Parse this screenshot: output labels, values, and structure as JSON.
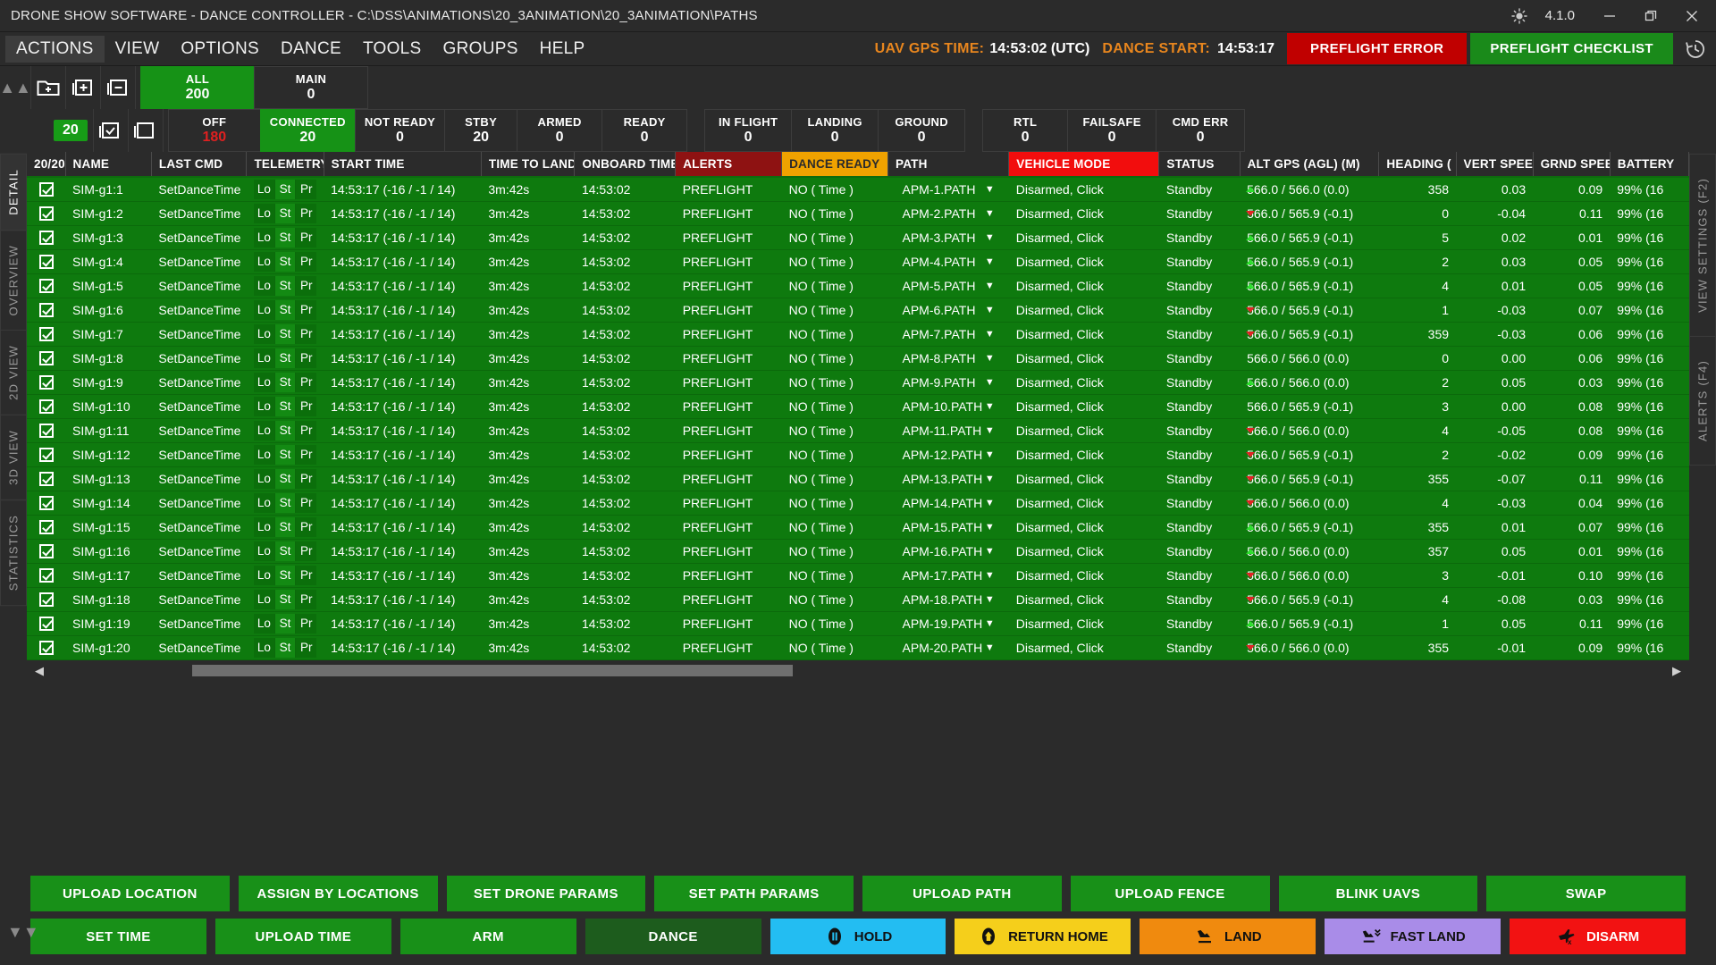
{
  "window": {
    "title": "DRONE SHOW SOFTWARE - DANCE CONTROLLER - C:\\DSS\\ANIMATIONS\\20_3ANIMATION\\20_3ANIMATION\\PATHS",
    "version": "4.1.0",
    "minimize_label": "—",
    "maximize_label": "❐",
    "close_label": "✕",
    "brightness_icon": "sun-icon"
  },
  "menu": {
    "items": [
      {
        "label": "ACTIONS",
        "active": true
      },
      {
        "label": "VIEW",
        "active": false
      },
      {
        "label": "OPTIONS",
        "active": false
      },
      {
        "label": "DANCE",
        "active": false
      },
      {
        "label": "TOOLS",
        "active": false
      },
      {
        "label": "GROUPS",
        "active": false
      },
      {
        "label": "HELP",
        "active": false
      }
    ],
    "gps_label": "UAV GPS TIME:",
    "gps_value": "14:53:02 (UTC)",
    "dance_start_label": "DANCE START:",
    "dance_start_value": "14:53:17",
    "preflight_error": "PREFLIGHT ERROR",
    "preflight_checklist": "PREFLIGHT CHECKLIST",
    "history_icon": "history-icon",
    "colors": {
      "accent_orange": "#e8861e",
      "error_red": "#c00000",
      "ok_green": "#1a8a1a"
    }
  },
  "toolbar": {
    "collapse_icon": "chevron-up-icon",
    "row1_icons": [
      "new-folder-icon",
      "add-group-icon",
      "remove-group-icon"
    ],
    "row2_icons": [
      "select-all-icon",
      "deselect-all-icon"
    ],
    "selected_count": "20",
    "groups": [
      {
        "label": "ALL",
        "value": "200",
        "highlight": true
      },
      {
        "label": "MAIN",
        "value": "0",
        "highlight": false
      }
    ],
    "statuses_a": [
      {
        "label": "OFF",
        "value": "180",
        "value_red": true,
        "highlight": false
      },
      {
        "label": "CONNECTED",
        "value": "20",
        "value_red": false,
        "highlight": true
      },
      {
        "label": "NOT READY",
        "value": "0",
        "value_red": false,
        "highlight": false
      },
      {
        "label": "STBY",
        "value": "20",
        "value_red": false,
        "highlight": false
      },
      {
        "label": "ARMED",
        "value": "0",
        "value_red": false,
        "highlight": false
      },
      {
        "label": "READY",
        "value": "0",
        "value_red": false,
        "highlight": false
      }
    ],
    "statuses_b": [
      {
        "label": "IN FLIGHT",
        "value": "0"
      },
      {
        "label": "LANDING",
        "value": "0"
      },
      {
        "label": "GROUND",
        "value": "0"
      }
    ],
    "statuses_c": [
      {
        "label": "RTL",
        "value": "0"
      },
      {
        "label": "FAILSAFE",
        "value": "0"
      },
      {
        "label": "CMD ERR",
        "value": "0"
      }
    ]
  },
  "left_tabs": [
    {
      "label": "DETAIL",
      "active": true
    },
    {
      "label": "OVERVIEW",
      "active": false
    },
    {
      "label": "2D VIEW",
      "active": false
    },
    {
      "label": "3D VIEW",
      "active": false
    },
    {
      "label": "STATISTICS",
      "active": false
    }
  ],
  "right_tabs": [
    {
      "label": "VIEW SETTINGS  (F2)",
      "active": false
    },
    {
      "label": "ALERTS  (F4)",
      "active": false
    }
  ],
  "table": {
    "headers": [
      "20/20",
      "NAME",
      "LAST CMD",
      "TELEMETRY",
      "START TIME",
      "TIME TO LAND",
      "ONBOARD TIME",
      "ALERTS",
      "DANCE READY",
      "PATH",
      "VEHICLE MODE",
      "STATUS",
      "ALT GPS (AGL) (M)",
      "HEADING (",
      "VERT SPEED",
      "GRND SPEED",
      "BATTERY"
    ],
    "telemetry_sub": [
      "Lo",
      "St",
      "Pr"
    ],
    "rows": [
      {
        "checked": true,
        "name": "SIM-g1:1",
        "last_cmd": "SetDanceTime",
        "start_time": "14:53:17 (-16 / -1 / 14)",
        "time_to_land": "3m:42s",
        "onboard_time": "14:53:02",
        "alerts": "PREFLIGHT",
        "dance_ready": "NO ( Time )",
        "path": "APM-1.PATH",
        "vehicle_mode": "Disarmed, Click",
        "status": "Standby",
        "alt": "566.0 / 566.0 (0.0)",
        "trend": "up",
        "heading": "358",
        "vert_speed": "0.03",
        "grnd_speed": "0.09",
        "battery": "99% (16"
      },
      {
        "checked": true,
        "name": "SIM-g1:2",
        "last_cmd": "SetDanceTime",
        "start_time": "14:53:17 (-16 / -1 / 14)",
        "time_to_land": "3m:42s",
        "onboard_time": "14:53:02",
        "alerts": "PREFLIGHT",
        "dance_ready": "NO ( Time )",
        "path": "APM-2.PATH",
        "vehicle_mode": "Disarmed, Click",
        "status": "Standby",
        "alt": "566.0 / 565.9 (-0.1)",
        "trend": "down",
        "heading": "0",
        "vert_speed": "-0.04",
        "grnd_speed": "0.11",
        "battery": "99% (16"
      },
      {
        "checked": true,
        "name": "SIM-g1:3",
        "last_cmd": "SetDanceTime",
        "start_time": "14:53:17 (-16 / -1 / 14)",
        "time_to_land": "3m:42s",
        "onboard_time": "14:53:02",
        "alerts": "PREFLIGHT",
        "dance_ready": "NO ( Time )",
        "path": "APM-3.PATH",
        "vehicle_mode": "Disarmed, Click",
        "status": "Standby",
        "alt": "566.0 / 565.9 (-0.1)",
        "trend": "up",
        "heading": "5",
        "vert_speed": "0.02",
        "grnd_speed": "0.01",
        "battery": "99% (16"
      },
      {
        "checked": true,
        "name": "SIM-g1:4",
        "last_cmd": "SetDanceTime",
        "start_time": "14:53:17 (-16 / -1 / 14)",
        "time_to_land": "3m:42s",
        "onboard_time": "14:53:02",
        "alerts": "PREFLIGHT",
        "dance_ready": "NO ( Time )",
        "path": "APM-4.PATH",
        "vehicle_mode": "Disarmed, Click",
        "status": "Standby",
        "alt": "566.0 / 565.9 (-0.1)",
        "trend": "up",
        "heading": "2",
        "vert_speed": "0.03",
        "grnd_speed": "0.05",
        "battery": "99% (16"
      },
      {
        "checked": true,
        "name": "SIM-g1:5",
        "last_cmd": "SetDanceTime",
        "start_time": "14:53:17 (-16 / -1 / 14)",
        "time_to_land": "3m:42s",
        "onboard_time": "14:53:02",
        "alerts": "PREFLIGHT",
        "dance_ready": "NO ( Time )",
        "path": "APM-5.PATH",
        "vehicle_mode": "Disarmed, Click",
        "status": "Standby",
        "alt": "566.0 / 565.9 (-0.1)",
        "trend": "up",
        "heading": "4",
        "vert_speed": "0.01",
        "grnd_speed": "0.05",
        "battery": "99% (16"
      },
      {
        "checked": true,
        "name": "SIM-g1:6",
        "last_cmd": "SetDanceTime",
        "start_time": "14:53:17 (-16 / -1 / 14)",
        "time_to_land": "3m:42s",
        "onboard_time": "14:53:02",
        "alerts": "PREFLIGHT",
        "dance_ready": "NO ( Time )",
        "path": "APM-6.PATH",
        "vehicle_mode": "Disarmed, Click",
        "status": "Standby",
        "alt": "566.0 / 565.9 (-0.1)",
        "trend": "down",
        "heading": "1",
        "vert_speed": "-0.03",
        "grnd_speed": "0.07",
        "battery": "99% (16"
      },
      {
        "checked": true,
        "name": "SIM-g1:7",
        "last_cmd": "SetDanceTime",
        "start_time": "14:53:17 (-16 / -1 / 14)",
        "time_to_land": "3m:42s",
        "onboard_time": "14:53:02",
        "alerts": "PREFLIGHT",
        "dance_ready": "NO ( Time )",
        "path": "APM-7.PATH",
        "vehicle_mode": "Disarmed, Click",
        "status": "Standby",
        "alt": "566.0 / 565.9 (-0.1)",
        "trend": "down",
        "heading": "359",
        "vert_speed": "-0.03",
        "grnd_speed": "0.06",
        "battery": "99% (16"
      },
      {
        "checked": true,
        "name": "SIM-g1:8",
        "last_cmd": "SetDanceTime",
        "start_time": "14:53:17 (-16 / -1 / 14)",
        "time_to_land": "3m:42s",
        "onboard_time": "14:53:02",
        "alerts": "PREFLIGHT",
        "dance_ready": "NO ( Time )",
        "path": "APM-8.PATH",
        "vehicle_mode": "Disarmed, Click",
        "status": "Standby",
        "alt": "566.0 / 566.0 (0.0)",
        "trend": "none",
        "heading": "0",
        "vert_speed": "0.00",
        "grnd_speed": "0.06",
        "battery": "99% (16"
      },
      {
        "checked": true,
        "name": "SIM-g1:9",
        "last_cmd": "SetDanceTime",
        "start_time": "14:53:17 (-16 / -1 / 14)",
        "time_to_land": "3m:42s",
        "onboard_time": "14:53:02",
        "alerts": "PREFLIGHT",
        "dance_ready": "NO ( Time )",
        "path": "APM-9.PATH",
        "vehicle_mode": "Disarmed, Click",
        "status": "Standby",
        "alt": "566.0 / 566.0 (0.0)",
        "trend": "up",
        "heading": "2",
        "vert_speed": "0.05",
        "grnd_speed": "0.03",
        "battery": "99% (16"
      },
      {
        "checked": true,
        "name": "SIM-g1:10",
        "last_cmd": "SetDanceTime",
        "start_time": "14:53:17 (-16 / -1 / 14)",
        "time_to_land": "3m:42s",
        "onboard_time": "14:53:02",
        "alerts": "PREFLIGHT",
        "dance_ready": "NO ( Time )",
        "path": "APM-10.PATH",
        "vehicle_mode": "Disarmed, Click",
        "status": "Standby",
        "alt": "566.0 / 565.9 (-0.1)",
        "trend": "none",
        "heading": "3",
        "vert_speed": "0.00",
        "grnd_speed": "0.08",
        "battery": "99% (16"
      },
      {
        "checked": true,
        "name": "SIM-g1:11",
        "last_cmd": "SetDanceTime",
        "start_time": "14:53:17 (-16 / -1 / 14)",
        "time_to_land": "3m:42s",
        "onboard_time": "14:53:02",
        "alerts": "PREFLIGHT",
        "dance_ready": "NO ( Time )",
        "path": "APM-11.PATH",
        "vehicle_mode": "Disarmed, Click",
        "status": "Standby",
        "alt": "566.0 / 566.0 (0.0)",
        "trend": "down",
        "heading": "4",
        "vert_speed": "-0.05",
        "grnd_speed": "0.08",
        "battery": "99% (16"
      },
      {
        "checked": true,
        "name": "SIM-g1:12",
        "last_cmd": "SetDanceTime",
        "start_time": "14:53:17 (-16 / -1 / 14)",
        "time_to_land": "3m:42s",
        "onboard_time": "14:53:02",
        "alerts": "PREFLIGHT",
        "dance_ready": "NO ( Time )",
        "path": "APM-12.PATH",
        "vehicle_mode": "Disarmed, Click",
        "status": "Standby",
        "alt": "566.0 / 565.9 (-0.1)",
        "trend": "down",
        "heading": "2",
        "vert_speed": "-0.02",
        "grnd_speed": "0.09",
        "battery": "99% (16"
      },
      {
        "checked": true,
        "name": "SIM-g1:13",
        "last_cmd": "SetDanceTime",
        "start_time": "14:53:17 (-16 / -1 / 14)",
        "time_to_land": "3m:42s",
        "onboard_time": "14:53:02",
        "alerts": "PREFLIGHT",
        "dance_ready": "NO ( Time )",
        "path": "APM-13.PATH",
        "vehicle_mode": "Disarmed, Click",
        "status": "Standby",
        "alt": "566.0 / 565.9 (-0.1)",
        "trend": "down",
        "heading": "355",
        "vert_speed": "-0.07",
        "grnd_speed": "0.11",
        "battery": "99% (16"
      },
      {
        "checked": true,
        "name": "SIM-g1:14",
        "last_cmd": "SetDanceTime",
        "start_time": "14:53:17 (-16 / -1 / 14)",
        "time_to_land": "3m:42s",
        "onboard_time": "14:53:02",
        "alerts": "PREFLIGHT",
        "dance_ready": "NO ( Time )",
        "path": "APM-14.PATH",
        "vehicle_mode": "Disarmed, Click",
        "status": "Standby",
        "alt": "566.0 / 566.0 (0.0)",
        "trend": "down",
        "heading": "4",
        "vert_speed": "-0.03",
        "grnd_speed": "0.04",
        "battery": "99% (16"
      },
      {
        "checked": true,
        "name": "SIM-g1:15",
        "last_cmd": "SetDanceTime",
        "start_time": "14:53:17 (-16 / -1 / 14)",
        "time_to_land": "3m:42s",
        "onboard_time": "14:53:02",
        "alerts": "PREFLIGHT",
        "dance_ready": "NO ( Time )",
        "path": "APM-15.PATH",
        "vehicle_mode": "Disarmed, Click",
        "status": "Standby",
        "alt": "566.0 / 565.9 (-0.1)",
        "trend": "up",
        "heading": "355",
        "vert_speed": "0.01",
        "grnd_speed": "0.07",
        "battery": "99% (16"
      },
      {
        "checked": true,
        "name": "SIM-g1:16",
        "last_cmd": "SetDanceTime",
        "start_time": "14:53:17 (-16 / -1 / 14)",
        "time_to_land": "3m:42s",
        "onboard_time": "14:53:02",
        "alerts": "PREFLIGHT",
        "dance_ready": "NO ( Time )",
        "path": "APM-16.PATH",
        "vehicle_mode": "Disarmed, Click",
        "status": "Standby",
        "alt": "566.0 / 566.0 (0.0)",
        "trend": "up",
        "heading": "357",
        "vert_speed": "0.05",
        "grnd_speed": "0.01",
        "battery": "99% (16"
      },
      {
        "checked": true,
        "name": "SIM-g1:17",
        "last_cmd": "SetDanceTime",
        "start_time": "14:53:17 (-16 / -1 / 14)",
        "time_to_land": "3m:42s",
        "onboard_time": "14:53:02",
        "alerts": "PREFLIGHT",
        "dance_ready": "NO ( Time )",
        "path": "APM-17.PATH",
        "vehicle_mode": "Disarmed, Click",
        "status": "Standby",
        "alt": "566.0 / 566.0 (0.0)",
        "trend": "down",
        "heading": "3",
        "vert_speed": "-0.01",
        "grnd_speed": "0.10",
        "battery": "99% (16"
      },
      {
        "checked": true,
        "name": "SIM-g1:18",
        "last_cmd": "SetDanceTime",
        "start_time": "14:53:17 (-16 / -1 / 14)",
        "time_to_land": "3m:42s",
        "onboard_time": "14:53:02",
        "alerts": "PREFLIGHT",
        "dance_ready": "NO ( Time )",
        "path": "APM-18.PATH",
        "vehicle_mode": "Disarmed, Click",
        "status": "Standby",
        "alt": "566.0 / 565.9 (-0.1)",
        "trend": "down",
        "heading": "4",
        "vert_speed": "-0.08",
        "grnd_speed": "0.03",
        "battery": "99% (16"
      },
      {
        "checked": true,
        "name": "SIM-g1:19",
        "last_cmd": "SetDanceTime",
        "start_time": "14:53:17 (-16 / -1 / 14)",
        "time_to_land": "3m:42s",
        "onboard_time": "14:53:02",
        "alerts": "PREFLIGHT",
        "dance_ready": "NO ( Time )",
        "path": "APM-19.PATH",
        "vehicle_mode": "Disarmed, Click",
        "status": "Standby",
        "alt": "566.0 / 565.9 (-0.1)",
        "trend": "up",
        "heading": "1",
        "vert_speed": "0.05",
        "grnd_speed": "0.11",
        "battery": "99% (16"
      },
      {
        "checked": true,
        "name": "SIM-g1:20",
        "last_cmd": "SetDanceTime",
        "start_time": "14:53:17 (-16 / -1 / 14)",
        "time_to_land": "3m:42s",
        "onboard_time": "14:53:02",
        "alerts": "PREFLIGHT",
        "dance_ready": "NO ( Time )",
        "path": "APM-20.PATH",
        "vehicle_mode": "Disarmed, Click",
        "status": "Standby",
        "alt": "566.0 / 566.0 (0.0)",
        "trend": "down",
        "heading": "355",
        "vert_speed": "-0.01",
        "grnd_speed": "0.09",
        "battery": "99% (16"
      }
    ]
  },
  "actions_row1": [
    {
      "label": "UPLOAD LOCATION"
    },
    {
      "label": "ASSIGN BY LOCATIONS"
    },
    {
      "label": "SET DRONE PARAMS"
    },
    {
      "label": "SET PATH PARAMS"
    },
    {
      "label": "UPLOAD PATH"
    },
    {
      "label": "UPLOAD FENCE"
    },
    {
      "label": "BLINK UAVS"
    },
    {
      "label": "SWAP"
    }
  ],
  "actions_row2": [
    {
      "label": "SET TIME",
      "style": "green"
    },
    {
      "label": "UPLOAD TIME",
      "style": "green"
    },
    {
      "label": "ARM",
      "style": "green"
    },
    {
      "label": "DANCE",
      "style": "dark"
    }
  ],
  "flight_controls": [
    {
      "label": "HOLD",
      "style": "hold",
      "icon": "pause-icon"
    },
    {
      "label": "RETURN HOME",
      "style": "rth",
      "icon": "home-icon"
    },
    {
      "label": "LAND",
      "style": "land",
      "icon": "land-icon"
    },
    {
      "label": "FAST LAND",
      "style": "fast",
      "icon": "fast-land-icon"
    },
    {
      "label": "DISARM",
      "style": "disarm",
      "icon": "disarm-icon"
    }
  ],
  "scrollbar": {
    "left_arrow": "◀",
    "right_arrow": "▶"
  },
  "bottom_chevron": "chevron-down-icon"
}
